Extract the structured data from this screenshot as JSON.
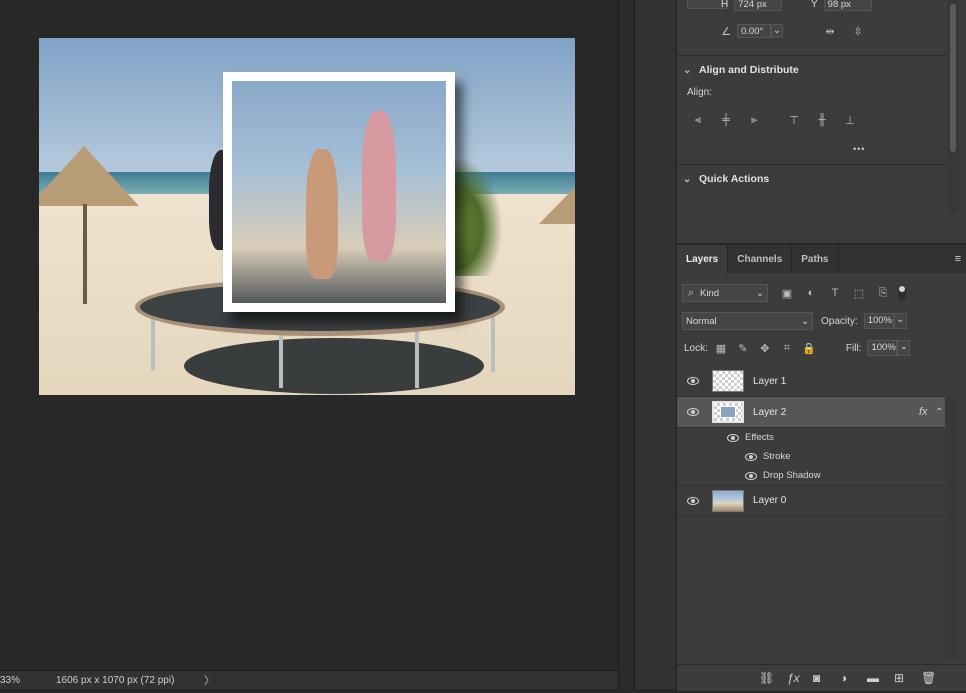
{
  "status_bar": {
    "zoom": "33%",
    "doc_info": "1606 px x 1070 px (72 ppi)",
    "arrow_icon": "chevron-right-icon"
  },
  "properties": {
    "h_label": "H",
    "h_value": "724 px",
    "y_label": "Y",
    "y_value": "98 px",
    "angle_value": "0.00°",
    "align_distribute_title": "Align and Distribute",
    "align_label": "Align:",
    "more_label": "•••",
    "quick_actions_title": "Quick Actions"
  },
  "layers_panel": {
    "tabs": [
      {
        "label": "Layers",
        "active": true
      },
      {
        "label": "Channels",
        "active": false
      },
      {
        "label": "Paths",
        "active": false
      }
    ],
    "filter_kind": "Kind",
    "blend_mode": "Normal",
    "opacity_label": "Opacity:",
    "opacity_value": "100%",
    "lock_label": "Lock:",
    "fill_label": "Fill:",
    "fill_value": "100%",
    "layers": [
      {
        "name": "Layer 1",
        "selected": false,
        "fx": ""
      },
      {
        "name": "Layer 2",
        "selected": true,
        "fx": "fx"
      },
      {
        "name": "Layer 0",
        "selected": false,
        "fx": ""
      }
    ],
    "effects_label": "Effects",
    "effects": [
      "Stroke",
      "Drop Shadow"
    ]
  },
  "colors": {
    "canvas_bg": "#282828",
    "panel_bg": "#3c3c3c",
    "selected_row": "#565656"
  }
}
